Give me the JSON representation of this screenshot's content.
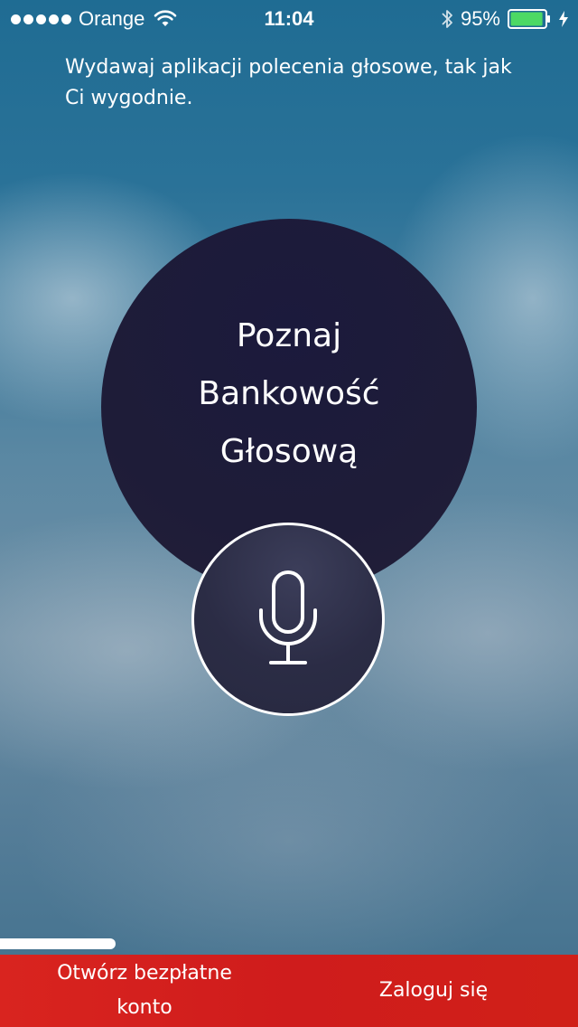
{
  "status_bar": {
    "carrier": "Orange",
    "time": "11:04",
    "battery": "95%",
    "battery_level": 0.95,
    "icons": [
      "signal-dots",
      "wifi-icon",
      "bluetooth-icon",
      "battery-icon",
      "charging-icon"
    ]
  },
  "instruction": "Wydawaj aplikacji polecenia głosowe, tak jak Ci wygodnie.",
  "intro": {
    "line1": "Poznaj",
    "line2": "Bankowość",
    "line3": "Głosową"
  },
  "mic": {
    "icon": "microphone-icon"
  },
  "bottom": {
    "open_account": "Otwórz bezpłatne konto",
    "login": "Zaloguj się"
  },
  "colors": {
    "bottom_bar": "#d42020",
    "circle": "#1e1c38",
    "battery_fill": "#4cd964"
  }
}
